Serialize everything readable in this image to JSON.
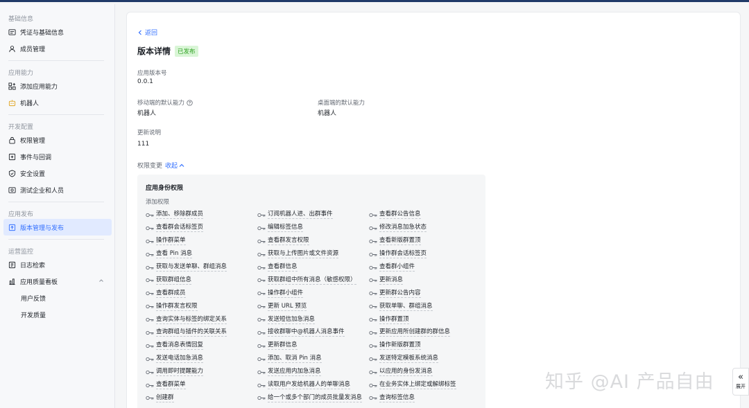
{
  "sidebar": {
    "groups": [
      {
        "title": "基础信息",
        "items": [
          {
            "label": "凭证与基础信息",
            "icon": "credential-icon"
          },
          {
            "label": "成员管理",
            "icon": "user-icon"
          }
        ]
      },
      {
        "title": "应用能力",
        "items": [
          {
            "label": "添加应用能力",
            "icon": "add-apps-icon"
          },
          {
            "label": "机器人",
            "icon": "robot-icon"
          }
        ]
      },
      {
        "title": "开发配置",
        "items": [
          {
            "label": "权限管理",
            "icon": "lock-icon"
          },
          {
            "label": "事件与回调",
            "icon": "event-icon"
          },
          {
            "label": "安全设置",
            "icon": "shield-icon"
          },
          {
            "label": "测试企业和人员",
            "icon": "test-icon"
          }
        ]
      },
      {
        "title": "应用发布",
        "items": [
          {
            "label": "版本管理与发布",
            "icon": "publish-icon",
            "active": true
          }
        ]
      },
      {
        "title": "运营监控",
        "items": [
          {
            "label": "日志检索",
            "icon": "log-icon"
          },
          {
            "label": "应用质量看板",
            "icon": "chart-icon",
            "expanded": true
          },
          {
            "label": "用户反馈",
            "sub": true
          },
          {
            "label": "开发质量",
            "sub": true
          }
        ]
      }
    ]
  },
  "detail": {
    "back_label": "返回",
    "title": "版本详情",
    "status_badge": "已发布",
    "version_label": "应用版本号",
    "version_value": "0.0.1",
    "mobile_label": "移动端的默认能力",
    "mobile_value": "机器人",
    "desktop_label": "桌面端的默认能力",
    "desktop_value": "机器人",
    "notes_label": "更新说明",
    "notes_value": "111",
    "perm_change_label": "权限变更",
    "collapse_label": "收起"
  },
  "permissions": {
    "section_title": "应用身份权限",
    "added_label": "添加权限",
    "items": [
      "添加、移除群成员",
      "订阅机器人进、出群事件",
      "查看群公告信息",
      "查看群会话标签页",
      "编辑标签信息",
      "修改消息加急状态",
      "操作群菜单",
      "查看群发言权限",
      "查看新版群置顶",
      "查看 Pin 消息",
      "获取与上传图片或文件资源",
      "操作群会话标签页",
      "获取与发送单聊、群组消息",
      "查看群信息",
      "查看群小组件",
      "获取群组信息",
      "获取群组中所有消息（敏感权限）",
      "更新消息",
      "查看群成员",
      "操作群小组件",
      "更新群公告内容",
      "操作群发言权限",
      "更新 URL 预览",
      "获取单聊、群组消息",
      "查询实体与标签的绑定关系",
      "发送短信加急消息",
      "操作群置顶",
      "查询群组与插件的关联关系",
      "接收群聊中@机器人消息事件",
      "更新应用所创建群的群信息",
      "查看消息表情回复",
      "更新群信息",
      "操作新版群置顶",
      "发送电话加急消息",
      "添加、取消 Pin 消息",
      "发送特定模板系统消息",
      "调用即时提醒能力",
      "发送应用内加急消息",
      "以应用的身份发消息",
      "查看群菜单",
      "读取用户发给机器人的单聊消息",
      "在业务实体上绑定或解绑标签",
      "创建群",
      "给一个或多个部门的成员批量发消息",
      "查询标签信息"
    ]
  },
  "watermark": "知乎 @AI 产品自由",
  "expand": {
    "label": "展开"
  },
  "colors": {
    "accent": "#3370ff",
    "success": "#2ea121",
    "frame": "#203a68"
  }
}
